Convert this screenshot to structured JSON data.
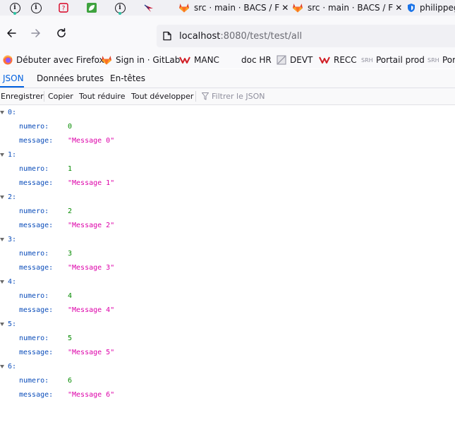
{
  "tabstrip": {
    "pinned": [
      {
        "icon": "info-circle-icon"
      },
      {
        "icon": "error-page-icon"
      },
      {
        "icon": "leaf-icon"
      },
      {
        "icon": "info-circle-icon"
      },
      {
        "icon": "bird-logo-icon"
      }
    ],
    "tabs": [
      {
        "title": "src · main · BACS / F",
        "close": "✕",
        "icon": "gitlab-fox-icon"
      },
      {
        "title": "src · main · BACS / F",
        "close": "✕",
        "icon": "gitlab-fox-icon"
      },
      {
        "title": "philippeg",
        "icon": "shield-icon"
      }
    ]
  },
  "navbar": {
    "url_host": "localhost",
    "url_rest": ":8080/test/test/all"
  },
  "bookmarks": [
    {
      "label": "Débuter avec Firefox",
      "icon": "firefox-icon"
    },
    {
      "label": "Sign in · GitLab",
      "icon": "gitlab-fox-icon"
    },
    {
      "label": "MANC",
      "icon": "red-logo-icon"
    },
    {
      "label": "doc HR",
      "icon": "blank-page-icon"
    },
    {
      "label": "DEVT",
      "icon": "page-icon"
    },
    {
      "label": "RECC",
      "icon": "red-logo-icon"
    },
    {
      "label": "Portail prod",
      "icon": "srh-icon"
    },
    {
      "label": "Por",
      "icon": "srh-icon"
    }
  ],
  "viewer": {
    "tabs": [
      "JSON",
      "Données brutes",
      "En-têtes"
    ],
    "selected_tab": "JSON",
    "toolbar": {
      "save": "Enregistrer",
      "copy": "Copier",
      "collapse_all": "Tout réduire",
      "expand_all": "Tout développer",
      "filter_placeholder": "Filtrer le JSON"
    }
  },
  "json_items": [
    {
      "index": "0:",
      "numero_key": "numero:",
      "numero": "0",
      "message_key": "message:",
      "message": "\"Message 0\""
    },
    {
      "index": "1:",
      "numero_key": "numero:",
      "numero": "1",
      "message_key": "message:",
      "message": "\"Message 1\""
    },
    {
      "index": "2:",
      "numero_key": "numero:",
      "numero": "2",
      "message_key": "message:",
      "message": "\"Message 2\""
    },
    {
      "index": "3:",
      "numero_key": "numero:",
      "numero": "3",
      "message_key": "message:",
      "message": "\"Message 3\""
    },
    {
      "index": "4:",
      "numero_key": "numero:",
      "numero": "4",
      "message_key": "message:",
      "message": "\"Message 4\""
    },
    {
      "index": "5:",
      "numero_key": "numero:",
      "numero": "5",
      "message_key": "message:",
      "message": "\"Message 5\""
    },
    {
      "index": "6:",
      "numero_key": "numero:",
      "numero": "6",
      "message_key": "message:",
      "message": "\"Message 6\""
    }
  ],
  "colors": {
    "accent": "#0060df",
    "json_key": "#0b4dba",
    "json_number": "#058b00",
    "json_string": "#dd00a9"
  }
}
